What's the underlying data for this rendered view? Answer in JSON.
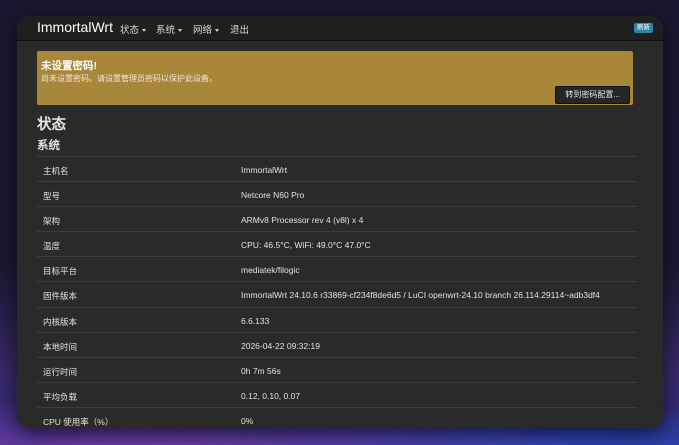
{
  "navbar": {
    "brand": "ImmortalWrt",
    "menu": [
      {
        "label": "状态",
        "dropdown": true
      },
      {
        "label": "系统",
        "dropdown": true
      },
      {
        "label": "网络",
        "dropdown": true
      },
      {
        "label": "退出",
        "dropdown": false
      }
    ],
    "badge": "刷新"
  },
  "alert": {
    "title": "未设置密码!",
    "text": "尚未设置密码。请设置管理员密码以保护此设备。",
    "button": "转到密码配置..."
  },
  "page": {
    "title": "状态",
    "section": "系统"
  },
  "system": [
    {
      "key": "主机名",
      "value": "ImmortalWrt"
    },
    {
      "key": "型号",
      "value": "Netcore N60 Pro"
    },
    {
      "key": "架构",
      "value": "ARMv8 Processor rev 4 (v8l) x 4"
    },
    {
      "key": "温度",
      "value": "CPU: 46.5°C, WiFi: 49.0°C 47.0°C"
    },
    {
      "key": "目标平台",
      "value": "mediatek/filogic"
    },
    {
      "key": "固件版本",
      "value": "ImmortalWrt 24.10.6 r33869-cf234f8de6d5 / LuCI openwrt-24.10 branch 26.114.29114~adb3df4"
    },
    {
      "key": "内核版本",
      "value": "6.6.133"
    },
    {
      "key": "本地时间",
      "value": "2026-04-22 09:32:19"
    },
    {
      "key": "运行时间",
      "value": "0h 7m 56s"
    },
    {
      "key": "平均负载",
      "value": "0.12, 0.10, 0.07"
    },
    {
      "key": "CPU 使用率（%）",
      "value": "0%"
    }
  ]
}
